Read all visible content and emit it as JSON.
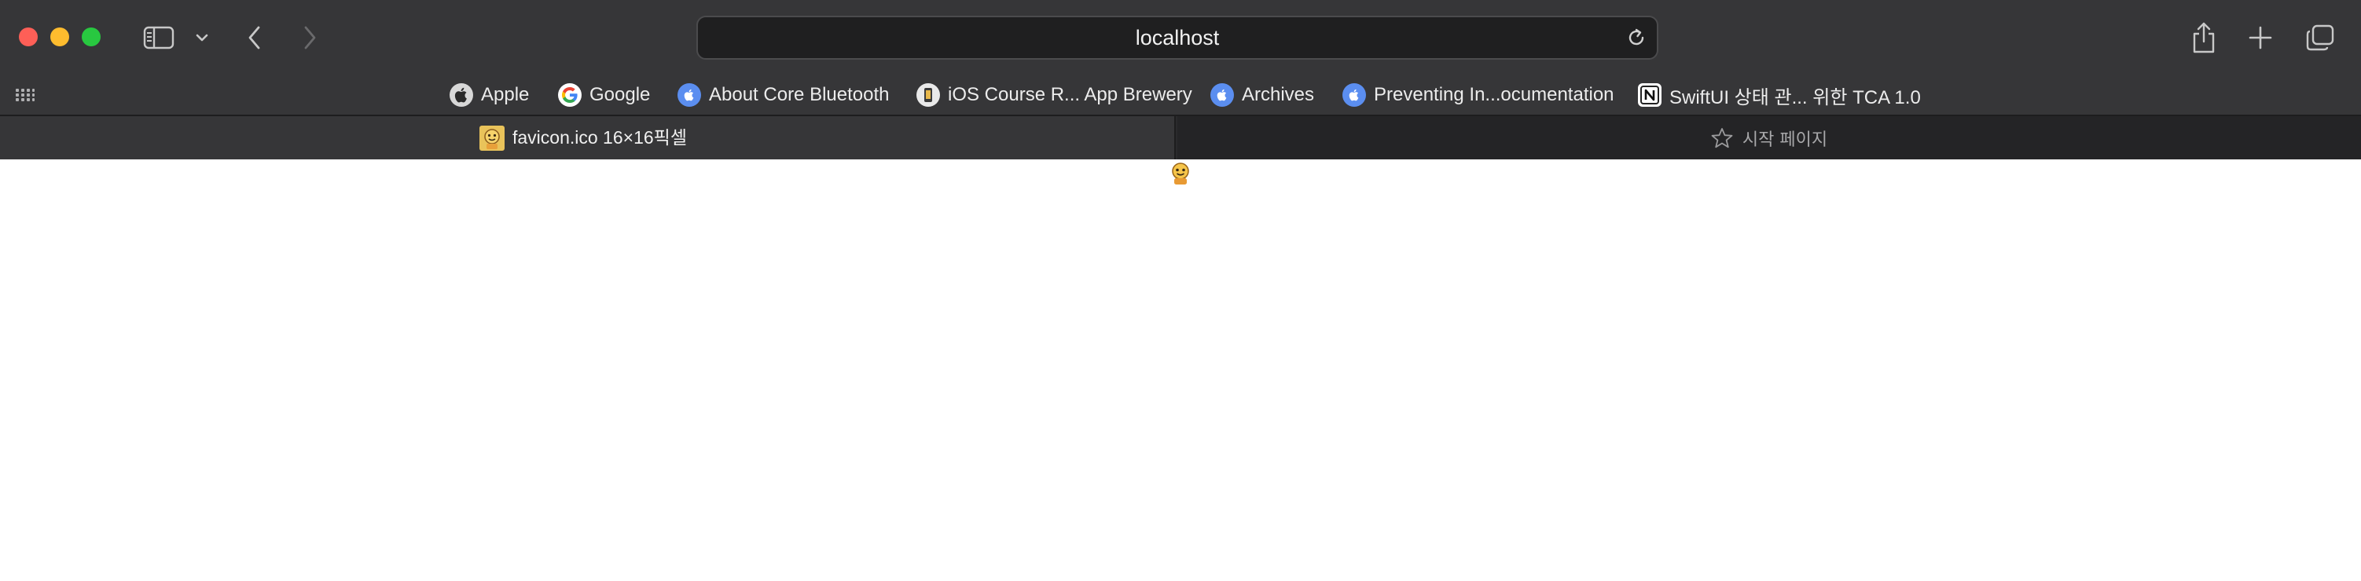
{
  "window": {
    "traffic_lights": {
      "close_color": "#fe5f57",
      "minimize_color": "#febc2e",
      "maximize_color": "#28c840"
    }
  },
  "toolbar": {
    "address": "localhost",
    "icons": [
      "sidebar-icon",
      "chevron-down-icon",
      "back-arrow-icon",
      "forward-arrow-icon",
      "reload-icon",
      "share-icon",
      "plus-icon",
      "tabs-overview-icon"
    ]
  },
  "favorites": {
    "items": [
      {
        "label": "Apple",
        "icon": "apple-icon"
      },
      {
        "label": "Google",
        "icon": "google-icon"
      },
      {
        "label": "About Core Bluetooth",
        "icon": "apple-developer-icon"
      },
      {
        "label": "iOS Course R... App Brewery",
        "icon": "app-brewery-icon"
      },
      {
        "label": "Archives",
        "icon": "apple-developer-icon"
      },
      {
        "label": "Preventing In...ocumentation",
        "icon": "apple-developer-icon"
      },
      {
        "label": "SwiftUI 상태 관... 위한 TCA 1.0",
        "icon": "notion-icon"
      }
    ]
  },
  "tabs": [
    {
      "title": "favicon.ico 16×16픽셀",
      "active": true,
      "icon": "favicon-icon"
    },
    {
      "title": "시작 페이지",
      "active": false,
      "icon": "star-icon"
    }
  ],
  "colors": {
    "toolbar_bg": "#363638",
    "tab_inactive_bg": "#242426",
    "content_bg": "#ffffff",
    "bookmark_blue": "#5b8ef0"
  }
}
